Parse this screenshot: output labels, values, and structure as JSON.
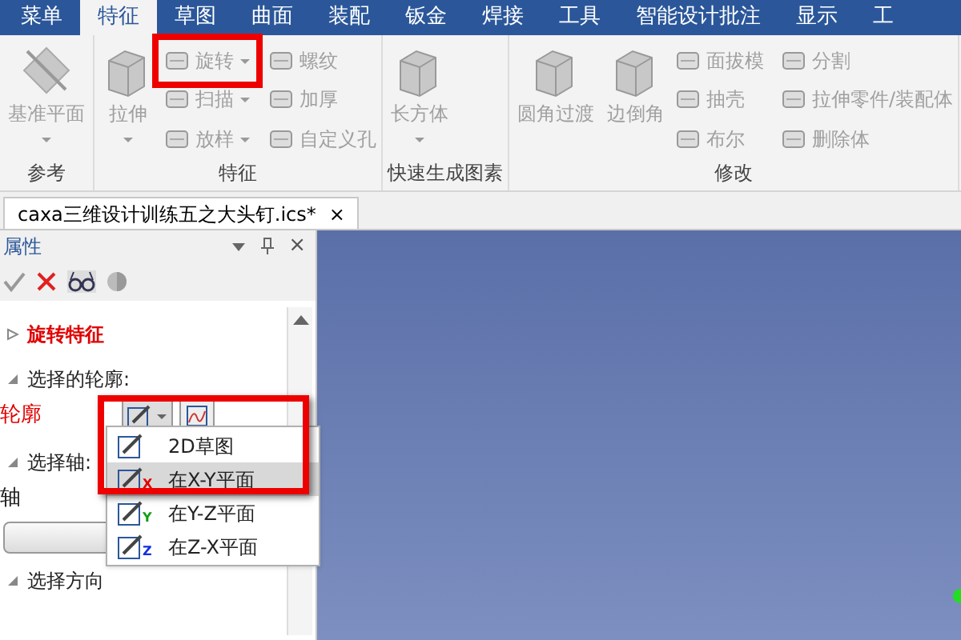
{
  "menu_tabs": [
    {
      "label": "菜单",
      "selected": false
    },
    {
      "label": "特征",
      "selected": true
    },
    {
      "label": "草图",
      "selected": false
    },
    {
      "label": "曲面",
      "selected": false
    },
    {
      "label": "装配",
      "selected": false
    },
    {
      "label": "钣金",
      "selected": false
    },
    {
      "label": "焊接",
      "selected": false
    },
    {
      "label": "工具",
      "selected": false
    },
    {
      "label": "智能设计批注",
      "selected": false
    },
    {
      "label": "显示",
      "selected": false
    },
    {
      "label": "工",
      "selected": false
    }
  ],
  "ribbon": {
    "groups": [
      {
        "title": "参考",
        "large": [
          {
            "label": "基准平面",
            "dropdown": true
          }
        ]
      },
      {
        "title": "特征",
        "large": [
          {
            "label": "拉伸",
            "dropdown": true
          }
        ],
        "small": [
          {
            "label": "旋转",
            "dropdown": true,
            "highlighted": true
          },
          {
            "label": "扫描",
            "dropdown": true
          },
          {
            "label": "放样",
            "dropdown": true
          },
          {
            "label": "螺纹",
            "dropdown": false
          },
          {
            "label": "加厚",
            "dropdown": false
          },
          {
            "label": "自定义孔",
            "dropdown": false
          }
        ]
      },
      {
        "title": "快速生成图素",
        "large": [
          {
            "label": "长方体",
            "dropdown": true
          }
        ]
      },
      {
        "title": "修改",
        "large": [
          {
            "label": "圆角过渡",
            "dropdown": false
          },
          {
            "label": "边倒角",
            "dropdown": false
          }
        ],
        "small": [
          {
            "label": "面拔模",
            "dropdown": false
          },
          {
            "label": "抽壳",
            "dropdown": false
          },
          {
            "label": "布尔",
            "dropdown": false
          },
          {
            "label": "分割",
            "dropdown": false
          },
          {
            "label": "拉伸零件/装配体",
            "dropdown": false
          },
          {
            "label": "删除体",
            "dropdown": false
          }
        ]
      }
    ]
  },
  "document_tab": {
    "title": "caxa三维设计训练五之大头钉.ics*",
    "close": "×"
  },
  "properties_panel": {
    "title": "属性",
    "close": "×",
    "tree": [
      {
        "kind": "section",
        "label": "旋转特征",
        "expanded": false,
        "highlight": true
      },
      {
        "kind": "section",
        "label": "选择的轮廓:",
        "expanded": true,
        "highlight": false
      },
      {
        "kind": "field",
        "label": "轮廓",
        "highlight": true
      },
      {
        "kind": "section",
        "label": "选择轴:",
        "expanded": true,
        "highlight": false
      },
      {
        "kind": "field",
        "label": "轴",
        "highlight": false
      },
      {
        "kind": "button"
      },
      {
        "kind": "section",
        "label": "选择方向",
        "expanded": true,
        "highlight": false
      }
    ]
  },
  "dropdown_menu": [
    {
      "label": "2D草图",
      "selected": false
    },
    {
      "label": "在X-Y平面",
      "axis": "X",
      "selected": true
    },
    {
      "label": "在Y-Z平面",
      "axis": "Y",
      "selected": false
    },
    {
      "label": "在Z-X平面",
      "axis": "Z",
      "selected": false
    }
  ]
}
